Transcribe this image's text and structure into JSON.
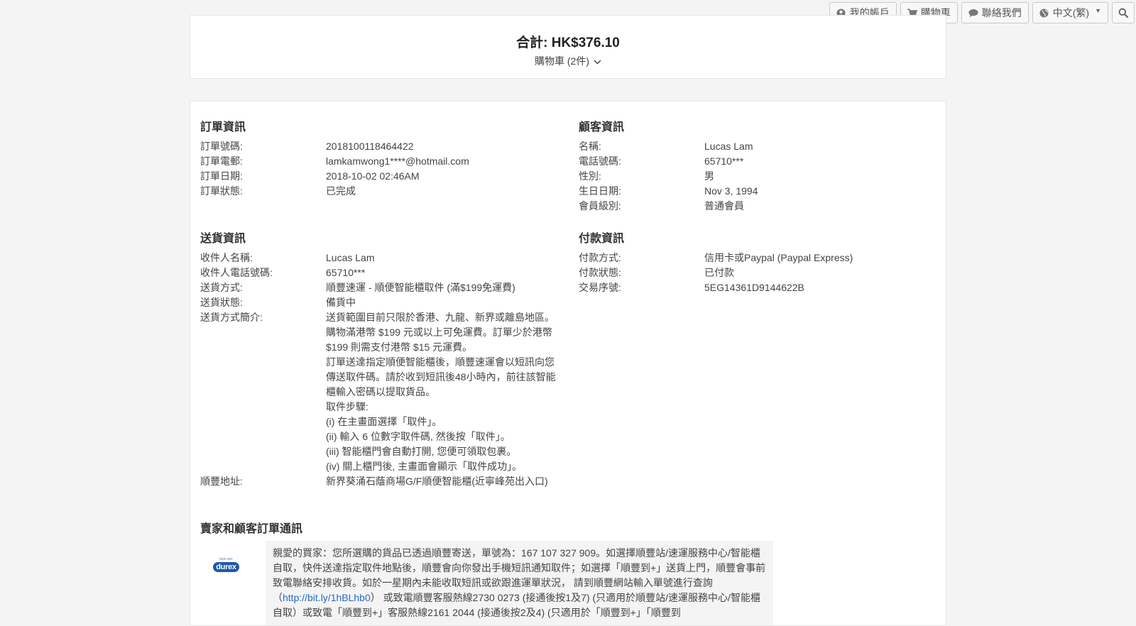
{
  "nav": {
    "account": "我的帳戶",
    "cart": "購物車",
    "contact": "聯絡我們",
    "language": "中文(繁)",
    "icons": {
      "account": "user-circle-icon",
      "cart": "cart-icon",
      "contact": "chat-bubble-icon",
      "language": "globe-icon",
      "search": "search-icon"
    }
  },
  "summary": {
    "total": "合計: HK$376.10",
    "cart_toggle": "購物車 (2件)"
  },
  "order_info": {
    "title": "訂單資訊",
    "rows": [
      {
        "label": "訂單號碼:",
        "value": "2018100118464422"
      },
      {
        "label": "訂單電郵:",
        "value": "lamkamwong1****@hotmail.com"
      },
      {
        "label": "訂單日期:",
        "value": "2018-10-02 02:46AM"
      },
      {
        "label": "訂單狀態:",
        "value": "已完成"
      }
    ]
  },
  "customer_info": {
    "title": "顧客資訊",
    "rows": [
      {
        "label": "名稱:",
        "value": "Lucas Lam"
      },
      {
        "label": "電話號碼:",
        "value": "65710***"
      },
      {
        "label": "性別:",
        "value": "男"
      },
      {
        "label": "生日日期:",
        "value": "Nov 3, 1994"
      },
      {
        "label": "會員級別:",
        "value": "普通會員"
      }
    ]
  },
  "delivery_info": {
    "title": "送貨資訊",
    "rows": [
      {
        "label": "收件人名稱:",
        "value": "Lucas Lam"
      },
      {
        "label": "收件人電話號碼:",
        "value": "65710***"
      },
      {
        "label": "送貨方式:",
        "value": "順豐速運 - 順便智能櫃取件 (滿$199免運費)"
      },
      {
        "label": "送貨狀態:",
        "value": "備貨中"
      }
    ],
    "method_desc_label": "送貨方式簡介:",
    "method_desc": [
      "送貨範圍目前只限於香港、九龍、新界或離島地區。購物滿港幣 $199 元或以上可免運費。訂單少於港幣 $199 則需支付港幣 $15 元運費。",
      "訂單送達指定順便智能櫃後，順豐速運會以短訊向您傳送取件碼。請於收到短訊後48小時內，前往該智能櫃輸入密碼以提取貨品。",
      "取件步驟:",
      "(i) 在主畫面選擇「取件」。",
      "(ii) 輸入 6 位數字取件碼, 然後按「取件」。",
      "(iii) 智能櫃門會自動打開, 您便可領取包裹。",
      "(iv) 關上櫃門後, 主畫面會顯示「取件成功」。"
    ],
    "address_label": "順豐地址:",
    "address": "新界葵涌石蔭商場G/F順便智能櫃(近寧峰苑出入口)"
  },
  "payment_info": {
    "title": "付款資訊",
    "rows": [
      {
        "label": "付款方式:",
        "value": "信用卡或Paypal (Paypal Express)"
      },
      {
        "label": "付款狀態:",
        "value": "已付款"
      },
      {
        "label": "交易序號:",
        "value": "5EG14361D9144622B"
      }
    ]
  },
  "communication": {
    "title": "賣家和顧客訂單通訊",
    "logo_top": "love sex",
    "logo_main": "durex",
    "message_part1": "親愛的買家：您所選購的貨品已透過順豐寄送，單號為：167 107 327 909。如選擇順豐站/速運服務中心/智能櫃自取，快件送達指定取件地點後，順豐會向你發出手機短訊通知取件；如選擇「順豐到+」送貨上門，順豐會事前致電聯絡安排收貨。如於一星期內未能收取短訊或欲跟進運單狀況， 請到順豐網站輸入單號進行查詢（",
    "link": "http://bit.ly/1hBLhb0",
    "message_part2": "） 或致電順豐客服熱線2730 0273 (接通後按1及7) (只適用於順豐站/速運服務中心/智能櫃自取）或致電「順豐到+」客服熱線2161 2044 (接通後按2及4) (只適用於「順豐到+」「順豐到"
  }
}
